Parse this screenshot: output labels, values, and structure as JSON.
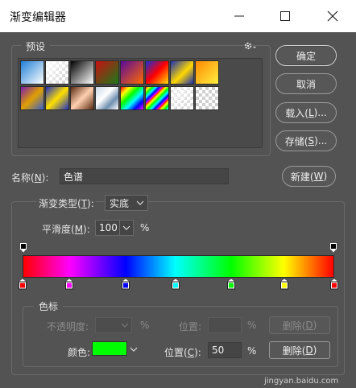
{
  "window": {
    "title": "渐变编辑器"
  },
  "presets": {
    "title": "预设"
  },
  "buttons": {
    "ok": "确定",
    "cancel": "取消",
    "load_pre": "载入(",
    "load_key": "L",
    "load_post": ")...",
    "save_pre": "存储(",
    "save_key": "S",
    "save_post": ")...",
    "new_pre": "新建(",
    "new_key": "W",
    "new_post": ")"
  },
  "name": {
    "label_pre": "名称(",
    "label_key": "N",
    "label_post": "):",
    "value": "色谱"
  },
  "gradient_type": {
    "label_pre": "渐变类型(",
    "label_key": "T",
    "label_post": "):",
    "value": "实底"
  },
  "smoothness": {
    "label_pre": "平滑度(",
    "label_key": "M",
    "label_post": "):",
    "value": "100",
    "unit": "%"
  },
  "gradient": {
    "colors": [
      "#ff0000",
      "#ff00ff",
      "#0000ff",
      "#00ffff",
      "#00ff00",
      "#ffff00",
      "#ff0000"
    ],
    "stops": [
      {
        "location": 0,
        "color": "#ff0000"
      },
      {
        "location": 15,
        "color": "#ff00ff"
      },
      {
        "location": 33,
        "color": "#0000ff"
      },
      {
        "location": 49,
        "color": "#00ffff"
      },
      {
        "location": 67,
        "color": "#00ff00"
      },
      {
        "location": 84,
        "color": "#ffff00"
      },
      {
        "location": 100,
        "color": "#ff0000"
      }
    ],
    "opacity_stops": [
      0,
      100
    ]
  },
  "color_stops": {
    "title": "色标",
    "opacity_label": "不透明度:",
    "opacity_unit": "%",
    "opacity_location_label": "位置:",
    "opacity_location_unit": "%",
    "opacity_delete_pre": "删除(",
    "opacity_delete_key": "D",
    "opacity_delete_post": ")",
    "color_label": "颜色:",
    "color_value": "#00ff00",
    "location_label_pre": "位置(",
    "location_label_key": "C",
    "location_label_post": "):",
    "location_value": "50",
    "location_unit": "%",
    "delete_pre": "删除(",
    "delete_key": "D",
    "delete_post": ")"
  },
  "watermark": "jingyan.baidu.com"
}
